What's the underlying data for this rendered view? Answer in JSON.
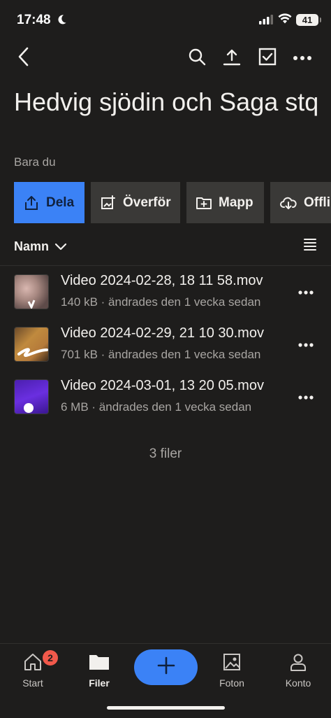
{
  "status_bar": {
    "time": "17:48",
    "battery": "41"
  },
  "header": {
    "title": "Hedvig sjödin och Saga stq",
    "subtitle": "Bara du"
  },
  "actions": {
    "share": "Dela",
    "transfer": "Överför",
    "folder": "Mapp",
    "offline": "Offline"
  },
  "sort": {
    "label": "Namn"
  },
  "files": [
    {
      "name": "Video 2024-02-28, 18 11 58.mov",
      "meta": "140 kB · ändrades den 1 vecka sedan"
    },
    {
      "name": "Video 2024-02-29, 21 10 30.mov",
      "meta": "701 kB · ändrades den 1 vecka sedan"
    },
    {
      "name": "Video 2024-03-01, 13 20 05.mov",
      "meta": "6 MB · ändrades den 1 vecka sedan"
    }
  ],
  "file_count": "3 filer",
  "tabs": {
    "start": "Start",
    "start_badge": "2",
    "files": "Filer",
    "photos": "Foton",
    "account": "Konto"
  },
  "colors": {
    "accent": "#3b82f6",
    "background": "#1e1d1c",
    "badge": "#f2594b"
  },
  "icons": [
    "moon-icon",
    "signal-icon",
    "wifi-icon",
    "back-icon",
    "search-icon",
    "upload-icon",
    "select-icon",
    "more-icon",
    "share-icon",
    "transfer-icon",
    "new-folder-icon",
    "offline-icon",
    "chevron-down-icon",
    "list-view-icon",
    "home-icon",
    "folder-icon",
    "plus-icon",
    "photos-icon",
    "account-icon"
  ]
}
